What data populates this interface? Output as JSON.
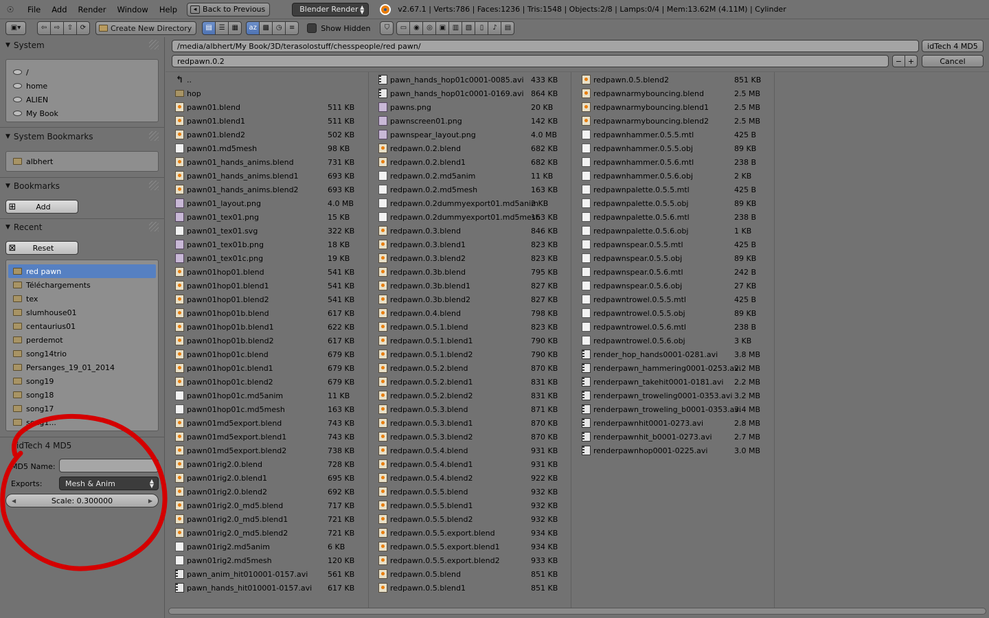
{
  "topbar": {
    "menu": [
      "File",
      "Add",
      "Render",
      "Window",
      "Help"
    ],
    "back_label": "Back to Previous",
    "engine": "Blender Render",
    "stats": "v2.67.1 | Verts:786 | Faces:1236 | Tris:1548 | Objects:2/8 | Lamps:0/4 | Mem:13.62M (4.11M) | Cylinder"
  },
  "toolbar": {
    "create_dir_label": "Create New Directory",
    "show_hidden_label": "Show Hidden"
  },
  "system": {
    "title": "System",
    "items": [
      "/",
      "home",
      "ALIEN",
      "My Book"
    ]
  },
  "system_bookmarks": {
    "title": "System Bookmarks",
    "items": [
      "albhert"
    ]
  },
  "bookmarks": {
    "title": "Bookmarks",
    "add_label": "Add"
  },
  "recent": {
    "title": "Recent",
    "reset_label": "Reset",
    "items": [
      "red pawn",
      "Téléchargements",
      "tex",
      "slumhouse01",
      "centaurius01",
      "perdemot",
      "song14trio",
      "Persanges_19_01_2014",
      "song19",
      "song18",
      "song17",
      "song1..."
    ]
  },
  "exporter": {
    "title": "idTech 4 MD5",
    "md5_name_label": "MD5 Name:",
    "md5_name_value": "",
    "exports_label": "Exports:",
    "exports_value": "Mesh & Anim",
    "scale_label": "Scale: 0.300000"
  },
  "main": {
    "path": "/media/albhert/My Book/3D/terasolostuff/chesspeople/red pawn/",
    "filename": "redpawn.0.2",
    "exec_label": "idTech 4 MD5",
    "cancel_label": "Cancel"
  },
  "columns": [
    [
      {
        "name": "..",
        "size": "",
        "icon": "up"
      },
      {
        "name": "hop",
        "size": "",
        "icon": "folder"
      },
      {
        "name": "pawn01.blend",
        "size": "511 KB",
        "icon": "blend"
      },
      {
        "name": "pawn01.blend1",
        "size": "511 KB",
        "icon": "blend"
      },
      {
        "name": "pawn01.blend2",
        "size": "502 KB",
        "icon": "blend"
      },
      {
        "name": "pawn01.md5mesh",
        "size": "98 KB",
        "icon": "file"
      },
      {
        "name": "pawn01_hands_anims.blend",
        "size": "731 KB",
        "icon": "blend"
      },
      {
        "name": "pawn01_hands_anims.blend1",
        "size": "693 KB",
        "icon": "blend"
      },
      {
        "name": "pawn01_hands_anims.blend2",
        "size": "693 KB",
        "icon": "blend"
      },
      {
        "name": "pawn01_layout.png",
        "size": "4.0 MB",
        "icon": "img"
      },
      {
        "name": "pawn01_tex01.png",
        "size": "15 KB",
        "icon": "img"
      },
      {
        "name": "pawn01_tex01.svg",
        "size": "322 KB",
        "icon": "file"
      },
      {
        "name": "pawn01_tex01b.png",
        "size": "18 KB",
        "icon": "img"
      },
      {
        "name": "pawn01_tex01c.png",
        "size": "19 KB",
        "icon": "img"
      },
      {
        "name": "pawn01hop01.blend",
        "size": "541 KB",
        "icon": "blend"
      },
      {
        "name": "pawn01hop01.blend1",
        "size": "541 KB",
        "icon": "blend"
      },
      {
        "name": "pawn01hop01.blend2",
        "size": "541 KB",
        "icon": "blend"
      },
      {
        "name": "pawn01hop01b.blend",
        "size": "617 KB",
        "icon": "blend"
      },
      {
        "name": "pawn01hop01b.blend1",
        "size": "622 KB",
        "icon": "blend"
      },
      {
        "name": "pawn01hop01b.blend2",
        "size": "617 KB",
        "icon": "blend"
      },
      {
        "name": "pawn01hop01c.blend",
        "size": "679 KB",
        "icon": "blend"
      },
      {
        "name": "pawn01hop01c.blend1",
        "size": "679 KB",
        "icon": "blend"
      },
      {
        "name": "pawn01hop01c.blend2",
        "size": "679 KB",
        "icon": "blend"
      },
      {
        "name": "pawn01hop01c.md5anim",
        "size": "11 KB",
        "icon": "file"
      },
      {
        "name": "pawn01hop01c.md5mesh",
        "size": "163 KB",
        "icon": "file"
      },
      {
        "name": "pawn01md5export.blend",
        "size": "743 KB",
        "icon": "blend"
      },
      {
        "name": "pawn01md5export.blend1",
        "size": "743 KB",
        "icon": "blend"
      },
      {
        "name": "pawn01md5export.blend2",
        "size": "738 KB",
        "icon": "blend"
      },
      {
        "name": "pawn01rig2.0.blend",
        "size": "728 KB",
        "icon": "blend"
      },
      {
        "name": "pawn01rig2.0.blend1",
        "size": "695 KB",
        "icon": "blend"
      },
      {
        "name": "pawn01rig2.0.blend2",
        "size": "692 KB",
        "icon": "blend"
      },
      {
        "name": "pawn01rig2.0_md5.blend",
        "size": "717 KB",
        "icon": "blend"
      },
      {
        "name": "pawn01rig2.0_md5.blend1",
        "size": "721 KB",
        "icon": "blend"
      },
      {
        "name": "pawn01rig2.0_md5.blend2",
        "size": "721 KB",
        "icon": "blend"
      },
      {
        "name": "pawn01rig2.md5anim",
        "size": "6 KB",
        "icon": "file"
      },
      {
        "name": "pawn01rig2.md5mesh",
        "size": "120 KB",
        "icon": "file"
      },
      {
        "name": "pawn_anim_hit010001-0157.avi",
        "size": "561 KB",
        "icon": "movie"
      },
      {
        "name": "pawn_hands_hit010001-0157.avi",
        "size": "617 KB",
        "icon": "movie"
      }
    ],
    [
      {
        "name": "pawn_hands_hop01c0001-0085.avi",
        "size": "433 KB",
        "icon": "movie"
      },
      {
        "name": "pawn_hands_hop01c0001-0169.avi",
        "size": "864 KB",
        "icon": "movie"
      },
      {
        "name": "pawns.png",
        "size": "20 KB",
        "icon": "img"
      },
      {
        "name": "pawnscreen01.png",
        "size": "142 KB",
        "icon": "img"
      },
      {
        "name": "pawnspear_layout.png",
        "size": "4.0 MB",
        "icon": "img"
      },
      {
        "name": "redpawn.0.2.blend",
        "size": "682 KB",
        "icon": "blend"
      },
      {
        "name": "redpawn.0.2.blend1",
        "size": "682 KB",
        "icon": "blend"
      },
      {
        "name": "redpawn.0.2.md5anim",
        "size": "11 KB",
        "icon": "file"
      },
      {
        "name": "redpawn.0.2.md5mesh",
        "size": "163 KB",
        "icon": "file"
      },
      {
        "name": "redpawn.0.2dummyexport01.md5anim",
        "size": "2 KB",
        "icon": "file"
      },
      {
        "name": "redpawn.0.2dummyexport01.md5mesh",
        "size": "163 KB",
        "icon": "file"
      },
      {
        "name": "redpawn.0.3.blend",
        "size": "846 KB",
        "icon": "blend"
      },
      {
        "name": "redpawn.0.3.blend1",
        "size": "823 KB",
        "icon": "blend"
      },
      {
        "name": "redpawn.0.3.blend2",
        "size": "823 KB",
        "icon": "blend"
      },
      {
        "name": "redpawn.0.3b.blend",
        "size": "795 KB",
        "icon": "blend"
      },
      {
        "name": "redpawn.0.3b.blend1",
        "size": "827 KB",
        "icon": "blend"
      },
      {
        "name": "redpawn.0.3b.blend2",
        "size": "827 KB",
        "icon": "blend"
      },
      {
        "name": "redpawn.0.4.blend",
        "size": "798 KB",
        "icon": "blend"
      },
      {
        "name": "redpawn.0.5.1.blend",
        "size": "823 KB",
        "icon": "blend"
      },
      {
        "name": "redpawn.0.5.1.blend1",
        "size": "790 KB",
        "icon": "blend"
      },
      {
        "name": "redpawn.0.5.1.blend2",
        "size": "790 KB",
        "icon": "blend"
      },
      {
        "name": "redpawn.0.5.2.blend",
        "size": "870 KB",
        "icon": "blend"
      },
      {
        "name": "redpawn.0.5.2.blend1",
        "size": "831 KB",
        "icon": "blend"
      },
      {
        "name": "redpawn.0.5.2.blend2",
        "size": "831 KB",
        "icon": "blend"
      },
      {
        "name": "redpawn.0.5.3.blend",
        "size": "871 KB",
        "icon": "blend"
      },
      {
        "name": "redpawn.0.5.3.blend1",
        "size": "870 KB",
        "icon": "blend"
      },
      {
        "name": "redpawn.0.5.3.blend2",
        "size": "870 KB",
        "icon": "blend"
      },
      {
        "name": "redpawn.0.5.4.blend",
        "size": "931 KB",
        "icon": "blend"
      },
      {
        "name": "redpawn.0.5.4.blend1",
        "size": "931 KB",
        "icon": "blend"
      },
      {
        "name": "redpawn.0.5.4.blend2",
        "size": "922 KB",
        "icon": "blend"
      },
      {
        "name": "redpawn.0.5.5.blend",
        "size": "932 KB",
        "icon": "blend"
      },
      {
        "name": "redpawn.0.5.5.blend1",
        "size": "932 KB",
        "icon": "blend"
      },
      {
        "name": "redpawn.0.5.5.blend2",
        "size": "932 KB",
        "icon": "blend"
      },
      {
        "name": "redpawn.0.5.5.export.blend",
        "size": "934 KB",
        "icon": "blend"
      },
      {
        "name": "redpawn.0.5.5.export.blend1",
        "size": "934 KB",
        "icon": "blend"
      },
      {
        "name": "redpawn.0.5.5.export.blend2",
        "size": "933 KB",
        "icon": "blend"
      },
      {
        "name": "redpawn.0.5.blend",
        "size": "851 KB",
        "icon": "blend"
      },
      {
        "name": "redpawn.0.5.blend1",
        "size": "851 KB",
        "icon": "blend"
      }
    ],
    [
      {
        "name": "redpawn.0.5.blend2",
        "size": "851 KB",
        "icon": "blend"
      },
      {
        "name": "redpawnarmybouncing.blend",
        "size": "2.5 MB",
        "icon": "blend"
      },
      {
        "name": "redpawnarmybouncing.blend1",
        "size": "2.5 MB",
        "icon": "blend"
      },
      {
        "name": "redpawnarmybouncing.blend2",
        "size": "2.5 MB",
        "icon": "blend"
      },
      {
        "name": "redpawnhammer.0.5.5.mtl",
        "size": "425 B",
        "icon": "file"
      },
      {
        "name": "redpawnhammer.0.5.5.obj",
        "size": "89 KB",
        "icon": "file"
      },
      {
        "name": "redpawnhammer.0.5.6.mtl",
        "size": "238 B",
        "icon": "file"
      },
      {
        "name": "redpawnhammer.0.5.6.obj",
        "size": "2 KB",
        "icon": "file"
      },
      {
        "name": "redpawnpalette.0.5.5.mtl",
        "size": "425 B",
        "icon": "file"
      },
      {
        "name": "redpawnpalette.0.5.5.obj",
        "size": "89 KB",
        "icon": "file"
      },
      {
        "name": "redpawnpalette.0.5.6.mtl",
        "size": "238 B",
        "icon": "file"
      },
      {
        "name": "redpawnpalette.0.5.6.obj",
        "size": "1 KB",
        "icon": "file"
      },
      {
        "name": "redpawnspear.0.5.5.mtl",
        "size": "425 B",
        "icon": "file"
      },
      {
        "name": "redpawnspear.0.5.5.obj",
        "size": "89 KB",
        "icon": "file"
      },
      {
        "name": "redpawnspear.0.5.6.mtl",
        "size": "242 B",
        "icon": "file"
      },
      {
        "name": "redpawnspear.0.5.6.obj",
        "size": "27 KB",
        "icon": "file"
      },
      {
        "name": "redpawntrowel.0.5.5.mtl",
        "size": "425 B",
        "icon": "file"
      },
      {
        "name": "redpawntrowel.0.5.5.obj",
        "size": "89 KB",
        "icon": "file"
      },
      {
        "name": "redpawntrowel.0.5.6.mtl",
        "size": "238 B",
        "icon": "file"
      },
      {
        "name": "redpawntrowel.0.5.6.obj",
        "size": "3 KB",
        "icon": "file"
      },
      {
        "name": "render_hop_hands0001-0281.avi",
        "size": "3.8 MB",
        "icon": "movie"
      },
      {
        "name": "renderpawn_hammering0001-0253.avi",
        "size": "2.2 MB",
        "icon": "movie"
      },
      {
        "name": "renderpawn_takehit0001-0181.avi",
        "size": "2.2 MB",
        "icon": "movie"
      },
      {
        "name": "renderpawn_troweling0001-0353.avi",
        "size": "3.2 MB",
        "icon": "movie"
      },
      {
        "name": "renderpawn_troweling_b0001-0353.avi",
        "size": "3.4 MB",
        "icon": "movie"
      },
      {
        "name": "renderpawnhit0001-0273.avi",
        "size": "2.8 MB",
        "icon": "movie"
      },
      {
        "name": "renderpawnhit_b0001-0273.avi",
        "size": "2.7 MB",
        "icon": "movie"
      },
      {
        "name": "renderpawnhop0001-0225.avi",
        "size": "3.0 MB",
        "icon": "movie"
      }
    ]
  ]
}
